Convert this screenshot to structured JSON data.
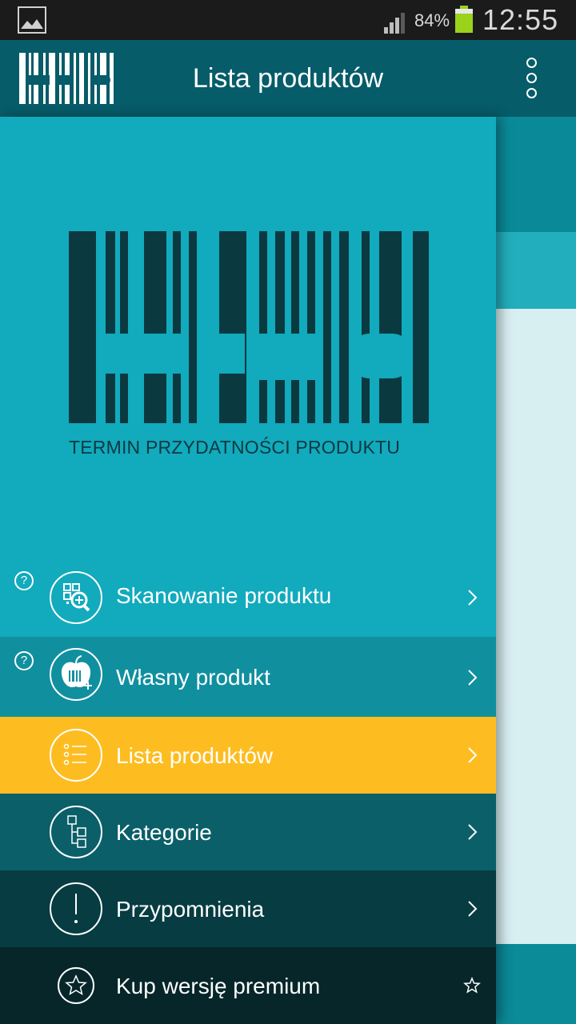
{
  "status_bar": {
    "battery_percent": "84%",
    "time": "12:55",
    "icons": [
      "picture-icon",
      "signal-icon",
      "battery-icon"
    ]
  },
  "app_bar": {
    "title": "Lista produktów",
    "icons": [
      "app-logo-icon",
      "overflow-menu-icon"
    ]
  },
  "drawer": {
    "logo_tagline": "TERMIN PRZYDATNOŚCI PRODUKTU",
    "items": [
      {
        "label": "Skanowanie produktu",
        "icon": "qr-scan-icon",
        "help": true,
        "bg": "#12aabd"
      },
      {
        "label": "Własny produkt",
        "icon": "apple-barcode-icon",
        "help": true,
        "bg": "#108f9f"
      },
      {
        "label": "Lista produktów",
        "icon": "list-icon",
        "help": false,
        "bg": "#fdbd21",
        "selected": true
      },
      {
        "label": "Kategorie",
        "icon": "category-tree-icon",
        "help": false,
        "bg": "#0b5f69"
      },
      {
        "label": "Przypomnienia",
        "icon": "exclamation-icon",
        "help": false,
        "bg": "#063c42"
      },
      {
        "label": "Kup wersję premium",
        "icon": "star-icon",
        "help": false,
        "bg": "#06262a"
      }
    ]
  },
  "colors": {
    "status_bar": "#1b1b1b",
    "app_bar": "#065c69",
    "drawer": "#12aabd",
    "selected": "#fdbd21"
  }
}
